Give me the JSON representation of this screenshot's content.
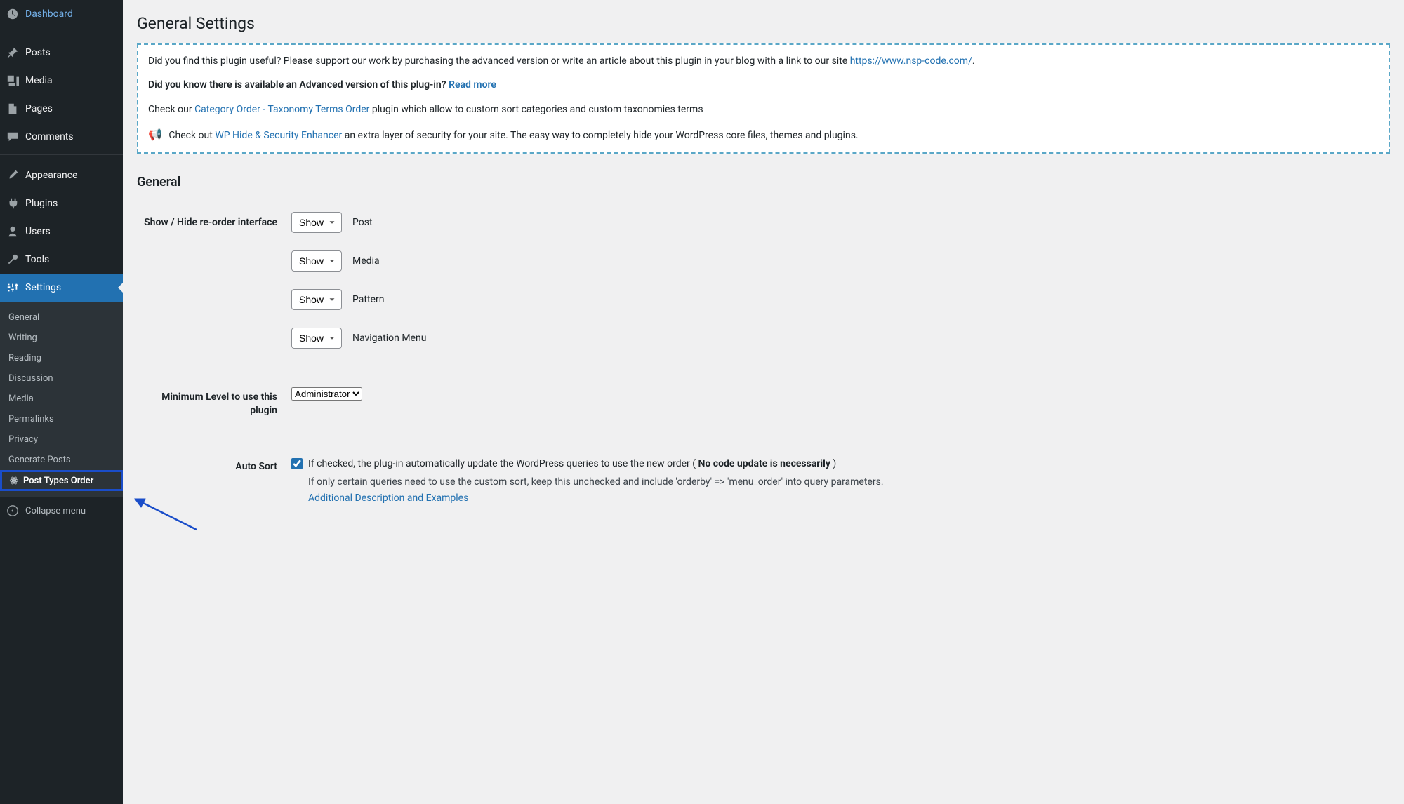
{
  "sidebar": {
    "items": [
      {
        "label": "Dashboard",
        "icon": "dashboard"
      },
      {
        "label": "Posts",
        "icon": "pin"
      },
      {
        "label": "Media",
        "icon": "media"
      },
      {
        "label": "Pages",
        "icon": "page"
      },
      {
        "label": "Comments",
        "icon": "comment"
      },
      {
        "label": "Appearance",
        "icon": "brush"
      },
      {
        "label": "Plugins",
        "icon": "plug"
      },
      {
        "label": "Users",
        "icon": "user"
      },
      {
        "label": "Tools",
        "icon": "wrench"
      },
      {
        "label": "Settings",
        "icon": "sliders",
        "active": true
      }
    ],
    "subitems": [
      {
        "label": "General"
      },
      {
        "label": "Writing"
      },
      {
        "label": "Reading"
      },
      {
        "label": "Discussion"
      },
      {
        "label": "Media"
      },
      {
        "label": "Permalinks"
      },
      {
        "label": "Privacy"
      },
      {
        "label": "Generate Posts"
      },
      {
        "label": "Post Types Order",
        "highlighted": true
      }
    ],
    "collapse": "Collapse menu"
  },
  "page": {
    "title": "General Settings"
  },
  "notice": {
    "support_prefix": "Did you find this plugin useful? Please support our work by purchasing the advanced version or write an article about this plugin in your blog with a link to our site ",
    "support_link": "https://www.nsp-code.com/",
    "period": ".",
    "advanced_prefix": "Did you know there is available an Advanced version of this plug-in? ",
    "advanced_link": "Read more",
    "category_prefix": "Check our ",
    "category_link": "Category Order - Taxonomy Terms Order",
    "category_suffix": " plugin which allow to custom sort categories and custom taxonomies terms",
    "wphide_prefix": "Check out ",
    "wphide_link": "WP Hide & Security Enhancer",
    "wphide_suffix": " an extra layer of security for your site. The easy way to completely hide your WordPress core files, themes and plugins."
  },
  "section": {
    "heading": "General",
    "show_hide_label": "Show / Hide re-order interface",
    "rows": [
      {
        "select": "Show",
        "text": "Post"
      },
      {
        "select": "Show",
        "text": "Media"
      },
      {
        "select": "Show",
        "text": "Pattern"
      },
      {
        "select": "Show",
        "text": "Navigation Menu"
      }
    ],
    "min_level_label": "Minimum Level to use this plugin",
    "min_level_value": "Administrator",
    "auto_sort_label": "Auto Sort",
    "auto_sort_desc_prefix": "If checked, the plug-in automatically update the WordPress queries to use the new order ( ",
    "auto_sort_desc_bold": "No code update is necessarily",
    "auto_sort_desc_suffix": " )",
    "auto_sort_secondary": "If only certain queries need to use the custom sort, keep this unchecked and include 'orderby' => 'menu_order' into query parameters.",
    "auto_sort_link": "Additional Description and Examples"
  }
}
